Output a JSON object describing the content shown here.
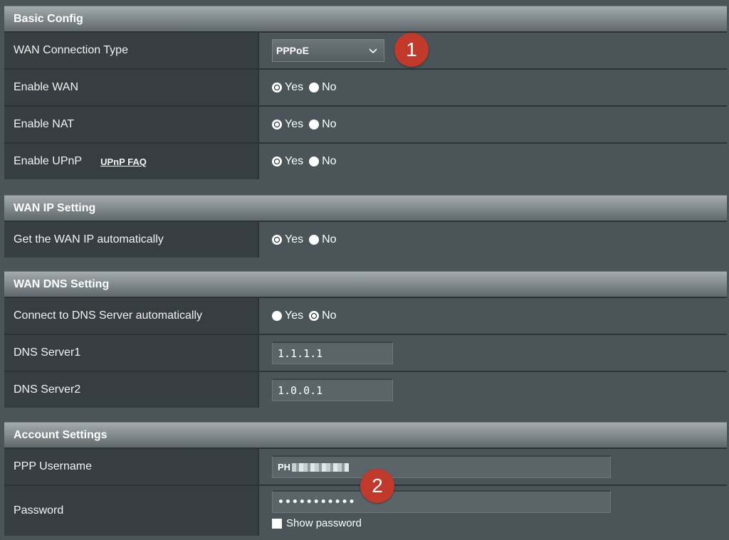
{
  "basic_config": {
    "title": "Basic Config",
    "wan_connection_type": {
      "label": "WAN Connection Type",
      "value": "PPPoE"
    },
    "enable_wan": {
      "label": "Enable WAN",
      "selected": "yes"
    },
    "enable_nat": {
      "label": "Enable NAT",
      "selected": "yes"
    },
    "enable_upnp": {
      "label": "Enable UPnP",
      "link": "UPnP  FAQ",
      "selected": "yes"
    }
  },
  "wan_ip_setting": {
    "title": "WAN IP Setting",
    "get_ip_auto": {
      "label": "Get the WAN IP automatically",
      "selected": "yes"
    }
  },
  "wan_dns_setting": {
    "title": "WAN DNS Setting",
    "dns_auto": {
      "label": "Connect to DNS Server automatically",
      "selected": "no"
    },
    "dns1": {
      "label": "DNS Server1",
      "value": "1.1.1.1"
    },
    "dns2": {
      "label": "DNS Server2",
      "value": "1.0.0.1"
    }
  },
  "account_settings": {
    "title": "Account Settings",
    "username": {
      "label": "PPP Username",
      "value": "PH"
    },
    "password": {
      "label": "Password",
      "value": "•••••••••••",
      "show_label": "Show password"
    }
  },
  "radio_labels": {
    "yes": "Yes",
    "no": "No"
  },
  "badges": {
    "one": "1",
    "two": "2"
  },
  "colors": {
    "badge": "#c0392b",
    "section_header_top": "#a3abad",
    "label_cell": "#363e42",
    "value_cell": "#4b5458"
  }
}
